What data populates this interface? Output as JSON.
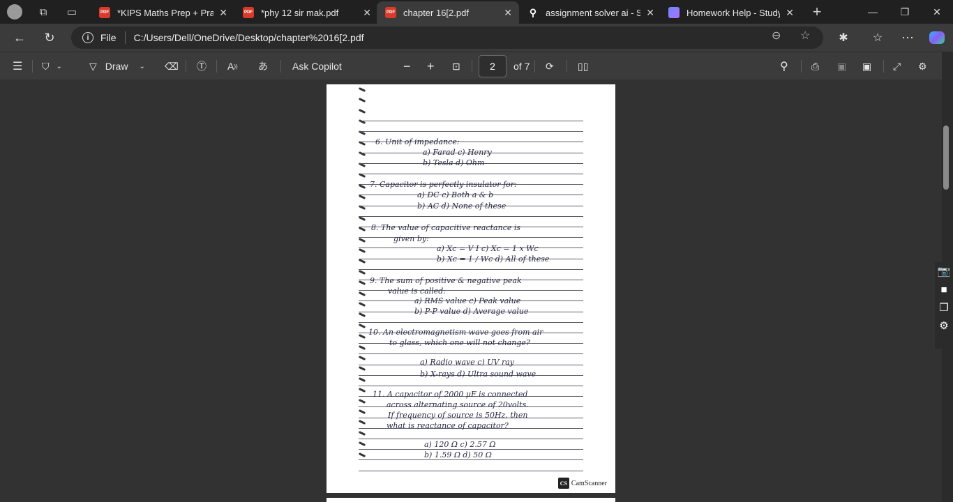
{
  "tabs": [
    {
      "title": "*KIPS Maths Prep + Practic",
      "icon": "pdf-icon",
      "active": false
    },
    {
      "title": "*phy 12 sir mak.pdf",
      "icon": "pdf-icon",
      "active": false
    },
    {
      "title": "chapter 16[2.pdf",
      "icon": "pdf-icon",
      "active": true
    },
    {
      "title": "assignment solver ai - Sear",
      "icon": "search-icon",
      "active": false
    },
    {
      "title": "Homework Help - StudyX",
      "icon": "studyx-icon",
      "active": false
    }
  ],
  "address": {
    "scheme_label": "File",
    "url": "C:/Users/Dell/OneDrive/Desktop/chapter%2016[2.pdf"
  },
  "pdf_toolbar": {
    "draw_label": "Draw",
    "ask_copilot_label": "Ask Copilot",
    "current_page": "2",
    "total_pages_label": "of 7"
  },
  "document": {
    "watermark": "CamScanner",
    "watermark_badge": "CS",
    "lines": [
      "6.  Unit  of  impedance:",
      "a)  Farad                              c)  Henry",
      "b)  Tesla                               d)  Ohm",
      "7.  Capacitor   is   perfectly   insulator   for:",
      "a)   DC                           c)  Both   a & b",
      "b)   AC                          d)  None of  these",
      "8.  The   value   of   capacitive   reactance   is",
      "given   by:",
      "a)  Xc = V I                c)  Xc = 1 x Wc",
      "b)  Xc = 1 / Wc              d)  All  of  these",
      "9.  The   sum   of   positive  &  negative  peak",
      "value   is   called:",
      "a)  RMS  value                c)   Peak  value",
      "b)  P-P  value                d)   Average  value",
      "10.  An   electromagnetism   wave   goes  from  air",
      "to   glass,   which   one   will   not  change?",
      "a)  Radio   wave              c)  UV  ray",
      "b)  X-rays                      d)  Ultra  sound  wave",
      "11.  A   capacitor   of   2000 μF   is   connected",
      "across   alternating   source   of   20volts.",
      "If   frequency   of   source   is   50Hz,   then",
      "what   is   reactance   of   capacitor?",
      "a)  120  Ω                       c)  2.57 Ω",
      "b)  1.59 Ω                       d)  50  Ω"
    ]
  }
}
